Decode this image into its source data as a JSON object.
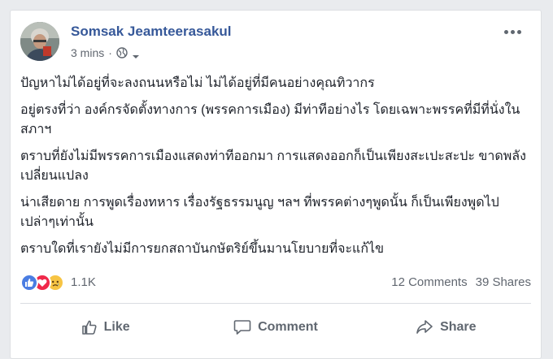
{
  "post": {
    "author": "Somsak Jeamteerasakul",
    "time": "3 mins",
    "separator": "·",
    "paragraphs": [
      "ปัญหาไม่ได้อยู่ที่จะลงถนนหรือไม่ ไม่ได้อยู่ที่มีคนอย่างคุณทิวากร",
      "อยู่ตรงที่ว่า องค์กรจัดตั้งทางการ (พรรคการเมือง) มีท่าทีอย่างไร โดยเฉพาะพรรคที่มีที่นั่งในสภาฯ",
      "ตราบที่ยังไม่มีพรรคการเมืองแสดงท่าทีออกมา การแสดงออกก็เป็นเพียงสะเปะสะปะ ขาดพลังเปลี่ยนแปลง",
      "น่าเสียดาย การพูดเรื่องทหาร เรื่องรัฐธรรมนูญ ฯลฯ ที่พรรคต่างๆพูดนั้น ก็เป็นเพียงพูดไป เปล่าๆเท่านั้น",
      "ตราบใดที่เรายังไม่มีการยกสถาบันกษัตริย์ขึ้นมานโยบายที่จะแก้ไข"
    ]
  },
  "reactions": {
    "count": "1.1K",
    "icons": [
      "like-reaction",
      "love-reaction",
      "sad-reaction"
    ],
    "comments": "12 Comments",
    "shares": "39 Shares"
  },
  "actions": {
    "like": "Like",
    "comment": "Comment",
    "share": "Share"
  },
  "colors": {
    "name_link": "#365899",
    "like_blue": "#4a7de2",
    "love_red": "#f0284a",
    "sad_yellow": "#f7c443",
    "muted_text": "#616770"
  }
}
